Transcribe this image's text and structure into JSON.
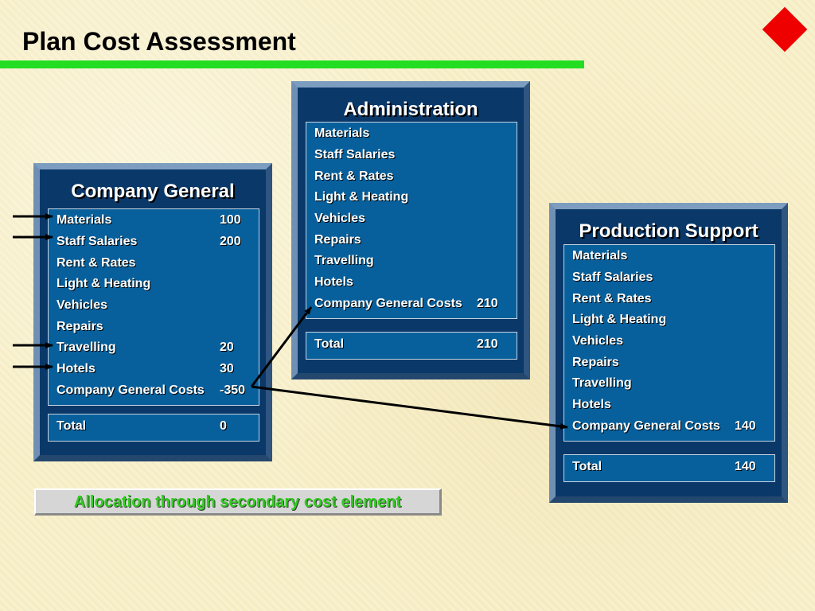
{
  "title": "Plan Cost Assessment",
  "colors": {
    "accent_rule": "#22dd22",
    "diamond": "#ee0000",
    "panel_bg": "#0a3869",
    "list_bg": "#07609c",
    "caption_text": "#33cc22"
  },
  "icons": {
    "corner": "red-diamond-icon"
  },
  "panels": {
    "company_general": {
      "title": "Company General",
      "items": [
        {
          "label": "Materials",
          "value": "100"
        },
        {
          "label": "Staff Salaries",
          "value": "200"
        },
        {
          "label": "Rent & Rates",
          "value": ""
        },
        {
          "label": "Light & Heating",
          "value": ""
        },
        {
          "label": "Vehicles",
          "value": ""
        },
        {
          "label": "Repairs",
          "value": ""
        },
        {
          "label": "Travelling",
          "value": "20"
        },
        {
          "label": "Hotels",
          "value": "30"
        },
        {
          "label": "Company General Costs",
          "value": "-350"
        }
      ],
      "total": {
        "label": "Total",
        "value": "0"
      }
    },
    "administration": {
      "title": "Administration",
      "items": [
        {
          "label": "Materials",
          "value": ""
        },
        {
          "label": "Staff Salaries",
          "value": ""
        },
        {
          "label": "Rent & Rates",
          "value": ""
        },
        {
          "label": "Light & Heating",
          "value": ""
        },
        {
          "label": "Vehicles",
          "value": ""
        },
        {
          "label": "Repairs",
          "value": ""
        },
        {
          "label": "Travelling",
          "value": ""
        },
        {
          "label": "Hotels",
          "value": ""
        },
        {
          "label": "Company General Costs",
          "value": "210"
        }
      ],
      "total": {
        "label": "Total",
        "value": "210"
      }
    },
    "production_support": {
      "title": "Production Support",
      "items": [
        {
          "label": "Materials",
          "value": ""
        },
        {
          "label": "Staff Salaries",
          "value": ""
        },
        {
          "label": "Rent & Rates",
          "value": ""
        },
        {
          "label": "Light & Heating",
          "value": ""
        },
        {
          "label": "Vehicles",
          "value": ""
        },
        {
          "label": "Repairs",
          "value": ""
        },
        {
          "label": "Travelling",
          "value": ""
        },
        {
          "label": "Hotels",
          "value": ""
        },
        {
          "label": "Company General Costs",
          "value": "140"
        }
      ],
      "total": {
        "label": "Total",
        "value": "140"
      }
    }
  },
  "caption": "Allocation through secondary cost element"
}
